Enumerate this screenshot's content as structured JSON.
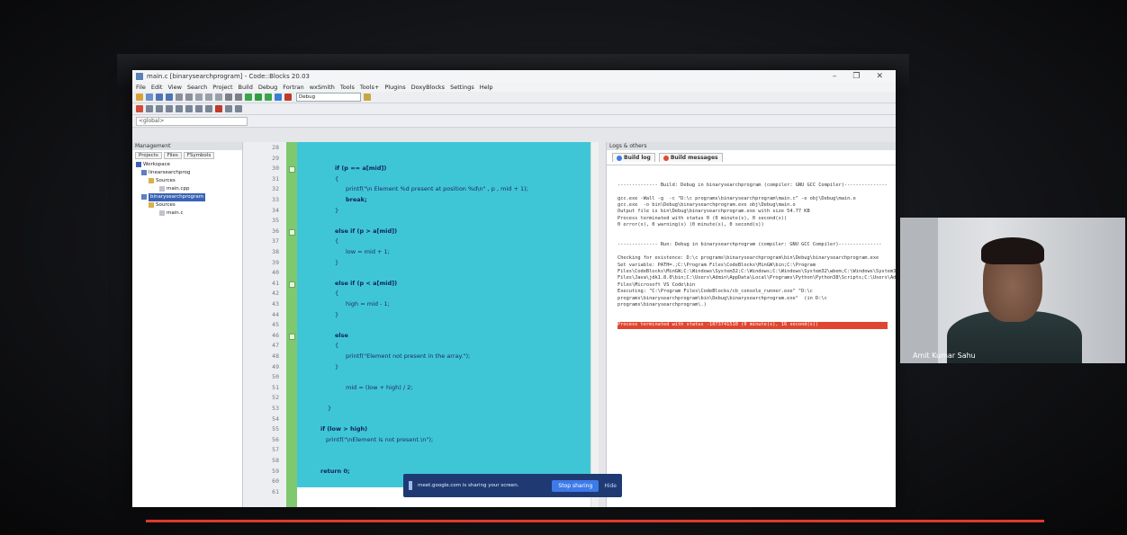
{
  "window": {
    "title": "main.c [binarysearchprogram] - Code::Blocks 20.03",
    "controls": [
      "–",
      "❐",
      "✕"
    ]
  },
  "menu": [
    "File",
    "Edit",
    "View",
    "Search",
    "Project",
    "Build",
    "Debug",
    "Fortran",
    "wxSmith",
    "Tools",
    "Tools+",
    "Plugins",
    "DoxyBlocks",
    "Settings",
    "Help"
  ],
  "toolbar": {
    "build_target": "Debug"
  },
  "scope": {
    "value": "<global>"
  },
  "management": {
    "title": "Management",
    "tabs": [
      "Projects",
      "Files",
      "FSymbols"
    ],
    "tree": [
      "Workspace",
      "linearsearchprog",
      "Sources",
      "main.cpp",
      "binarysearchprogram",
      "Sources",
      "main.c"
    ]
  },
  "editor": {
    "line_numbers": [
      "28",
      "29",
      "30",
      "31",
      "32",
      "33",
      "34",
      "35",
      "36",
      "37",
      "38",
      "39",
      "40",
      "41",
      "42",
      "43",
      "44",
      "45",
      "46",
      "47",
      "48",
      "49",
      "50",
      "51",
      "52",
      "53",
      "54",
      "55",
      "56",
      "57",
      "58",
      "59",
      "60",
      "61"
    ],
    "lines": [
      "",
      "",
      "if (p == a[mid])",
      "{",
      "printf(\"\\n Element %d present at position %d\\n\" , p , mid + 1);",
      "break;",
      "}",
      "",
      "else if (p > a[mid])",
      "{",
      "low = mid + 1;",
      "}",
      "",
      "else if (p < a[mid])",
      "{",
      "high = mid - 1;",
      "}",
      "",
      "else",
      "{",
      "printf(\"Element not present in the array.\");",
      "}",
      "",
      "mid = (low + high) / 2;",
      "",
      "}",
      "",
      "if (low > high)",
      "printf(\"\\nElement is not present.\\n\");",
      "",
      "",
      "return 0;",
      "",
      ""
    ]
  },
  "logs": {
    "title": "Logs & others",
    "tabs": [
      "Build log",
      "Build messages"
    ],
    "build_lines": [
      "-------------- Build: Debug in binarysearchprogram (compiler: GNU GCC Compiler)---------------",
      "",
      "gcc.exe -Wall -g  -c \"D:\\c programs\\binarysearchprogram\\main.c\" -o obj\\Debug\\main.o",
      "gcc.exe  -o bin\\Debug\\binarysearchprogram.exe obj\\Debug\\main.o",
      "Output file is bin\\Debug\\binarysearchprogram.exe with size 54.77 KB",
      "Process terminated with status 0 (0 minute(s), 0 second(s))",
      "0 error(s), 0 warning(s) (0 minute(s), 0 second(s))",
      "",
      "",
      "-------------- Run: Debug in binarysearchprogram (compiler: GNU GCC Compiler)---------------",
      "",
      "Checking for existence: D:\\c programs\\binarysearchprogram\\bin\\Debug\\binarysearchprogram.exe",
      "Set variable: PATH=.;C:\\Program Files\\CodeBlocks\\MinGW\\bin;C:\\Program Files\\CodeBlocks\\MinGW;C:\\Windows\\System32;C:\\Windows;C:\\Windows\\System32\\wbem;C:\\Windows\\System32\\WindowsPowerShell\\v1.0;C:\\Program Files\\Java\\jdk1.8.0\\bin;C:\\Users\\Admin\\AppData\\Local\\Programs\\Python\\Python38\\Scripts;C:\\Users\\Admin\\AppData\\Local\\Programs\\Python\\Python38;C:\\Program Files\\Microsoft VS Code\\bin",
      "Executing: \"C:\\Program Files\\CodeBlocks/cb_console_runner.exe\" \"D:\\c programs\\binarysearchprogram\\bin\\Debug\\binarysearchprogram.exe\"  (in D:\\c programs\\binarysearchprogram\\.)"
    ],
    "error_line": "Process terminated with status -1073741510 (0 minute(s), 16 second(s))"
  },
  "share_bar": {
    "text": "meet.google.com is sharing your screen.",
    "stop_label": "Stop sharing",
    "hide_label": "Hide"
  },
  "webcam": {
    "name": "Amit Kumar Sahu"
  },
  "colors": {
    "selection": "#3fc6d6",
    "fold": "#7fc86e",
    "error": "#e0462f",
    "progress": "#e0392a"
  }
}
